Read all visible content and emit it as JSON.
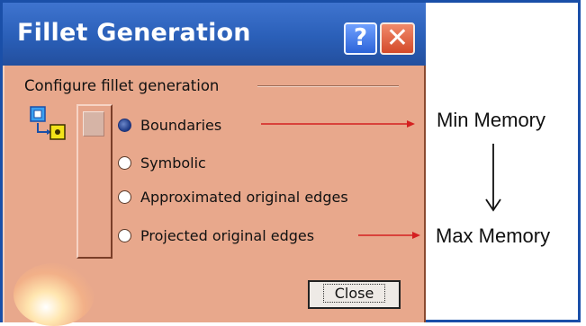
{
  "dialog": {
    "title": "Fillet Generation",
    "help_symbol": "?",
    "close_symbol": "✕",
    "section_label": "Configure fillet generation",
    "options": [
      {
        "label": "Boundaries",
        "selected": true
      },
      {
        "label": "Symbolic",
        "selected": false
      },
      {
        "label": "Approximated original edges",
        "selected": false
      },
      {
        "label": "Projected original edges",
        "selected": false
      }
    ],
    "close_button_label": "Close"
  },
  "annotations": {
    "min_label": "Min Memory",
    "max_label": "Max Memory",
    "arrow_color": "#d42020"
  },
  "colors": {
    "titlebar": "#2a5fb8",
    "dialog_bg": "#e8a88c",
    "frame_border": "#1a4fa8"
  }
}
